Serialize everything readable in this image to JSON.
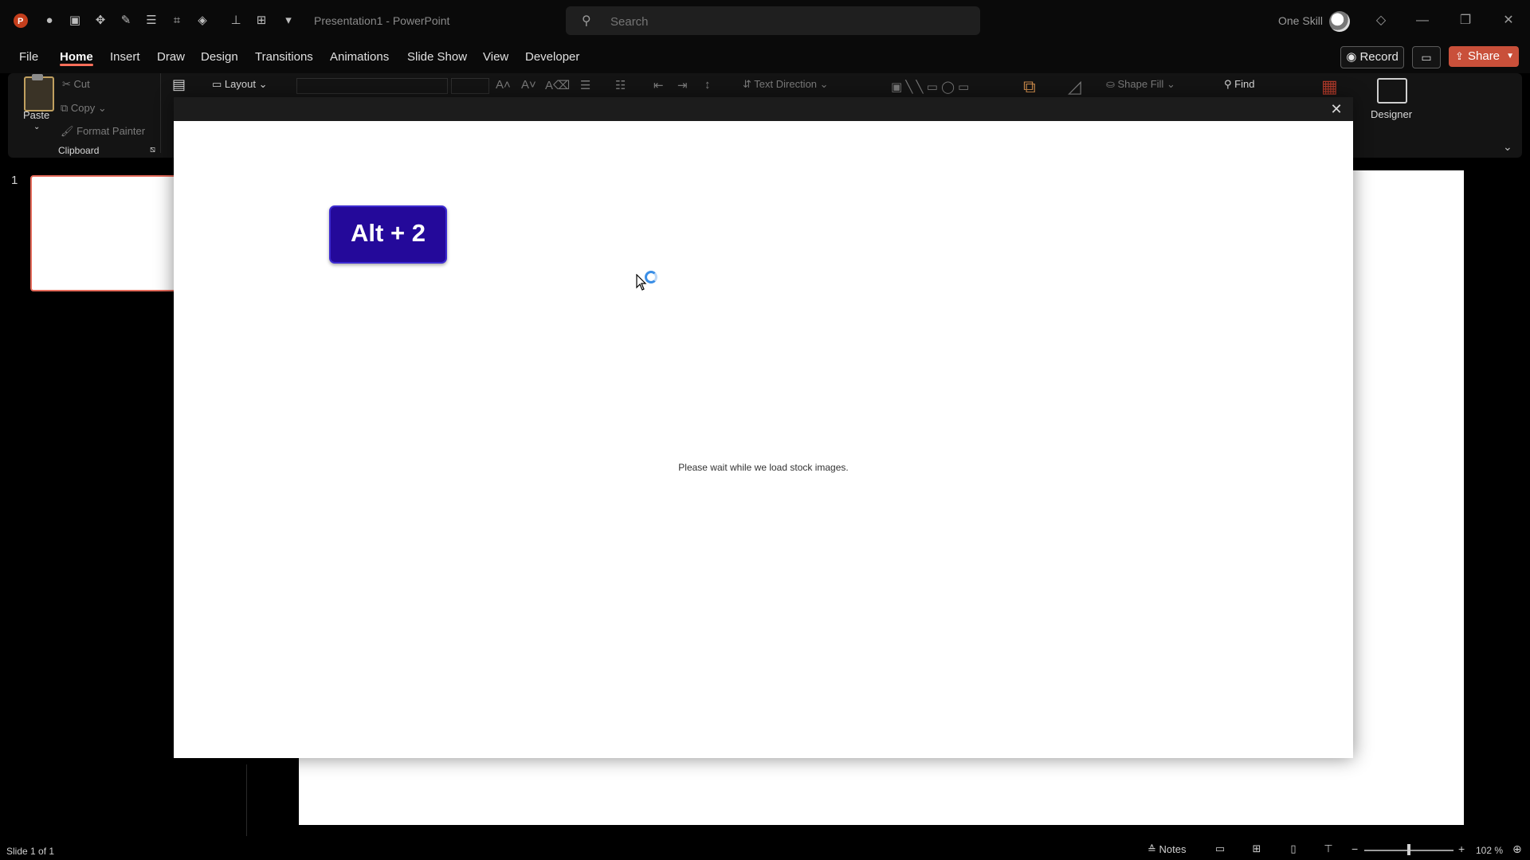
{
  "titlebar": {
    "doc_title": "Presentation1 - PowerPoint",
    "search_placeholder": "Search",
    "user_name": "One Skill"
  },
  "menu": {
    "items": [
      "File",
      "Home",
      "Insert",
      "Draw",
      "Design",
      "Transitions",
      "Animations",
      "Slide Show",
      "View",
      "Developer"
    ],
    "active": "Home",
    "record_label": "Record",
    "share_label": "Share"
  },
  "ribbon": {
    "paste": "Paste",
    "cut": "Cut",
    "copy": "Copy",
    "format_painter": "Format Painter",
    "clipboard_group": "Clipboard",
    "layout": "Layout",
    "text_direction": "Text Direction",
    "shape_fill": "Shape Fill",
    "find": "Find",
    "designer": "Designer"
  },
  "slides_pane": {
    "slide_number": "1"
  },
  "dialog": {
    "loading_text": "Please wait while we load stock images."
  },
  "overlay": {
    "keystroke": "Alt + 2"
  },
  "statusbar": {
    "slide_info": "Slide 1 of 1",
    "notes": "Notes",
    "zoom": "102 %"
  },
  "colors": {
    "accent": "#ff6f5a",
    "share": "#c9503a",
    "keystroke_bg": "#24099a",
    "spinner": "#3a8ee6"
  }
}
